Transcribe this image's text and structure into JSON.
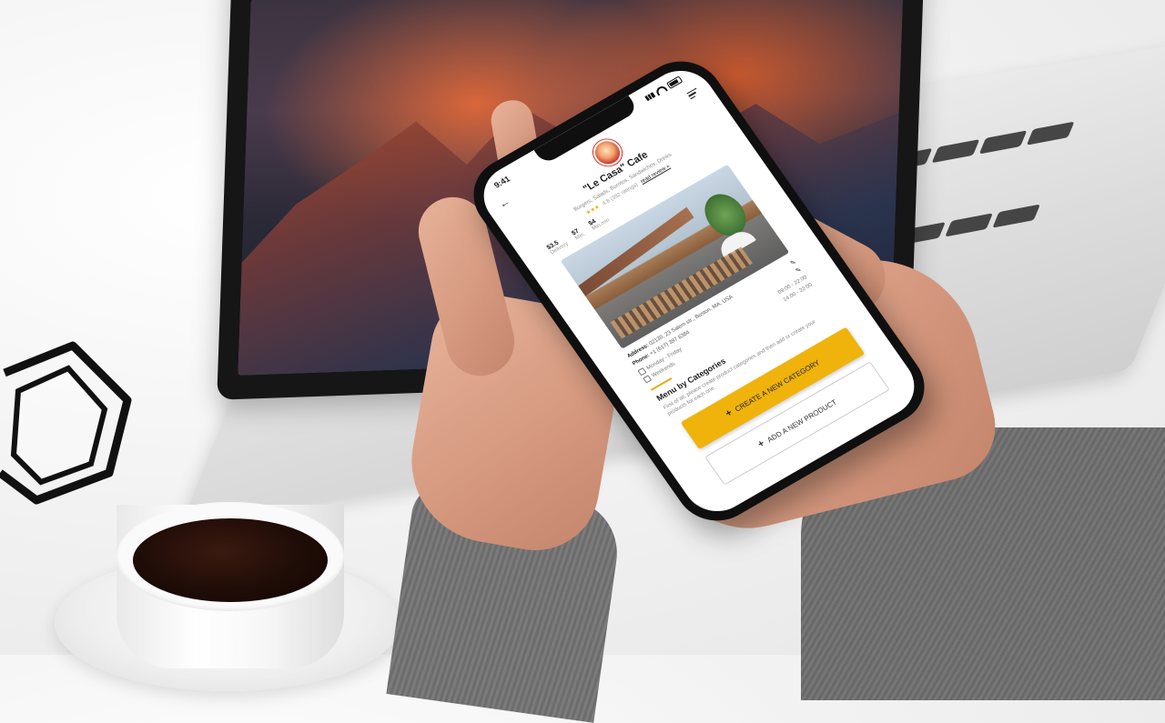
{
  "phone": {
    "status_time": "9:41",
    "cafe_name": "\"Le Casa\" Cafe",
    "cafe_tags": "Burgers, Salads, Burritos, Sandwiches, Drinks",
    "rating_value": "4.8 (392 ratings)",
    "rating_stars": "★★★",
    "read_reviews": "read review »",
    "stats": [
      {
        "value": "$3.5",
        "label": "Delivery"
      },
      {
        "value": "$7",
        "label": "Min."
      },
      {
        "value": "$4",
        "label": "Min.min"
      }
    ],
    "address_label": "Address:",
    "address_value": "02130, 23 Salem str., Boston, MA, USA",
    "phone_label": "Phone:",
    "phone_value": "+1 (617) 397 8384",
    "hours": [
      {
        "days": "Monday - Friday",
        "time": "09:00 - 22:00"
      },
      {
        "days": "Weekends",
        "time": "14:00 - 22:00"
      }
    ],
    "menu_title": "Menu by Categories",
    "menu_desc": "First of all, please create product categories and then add or create your products for each one.",
    "btn_create_category": "CREATE A NEW CATEGORY",
    "btn_add_product": "ADD A NEW PRODUCT"
  },
  "colors": {
    "accent": "#efb30b",
    "phone_body": "#0f0f0f"
  },
  "icons": [
    "back-arrow-icon",
    "menu-icon",
    "signal-icon",
    "wifi-icon",
    "battery-icon",
    "calendar-icon",
    "pencil-icon",
    "plus-icon"
  ]
}
